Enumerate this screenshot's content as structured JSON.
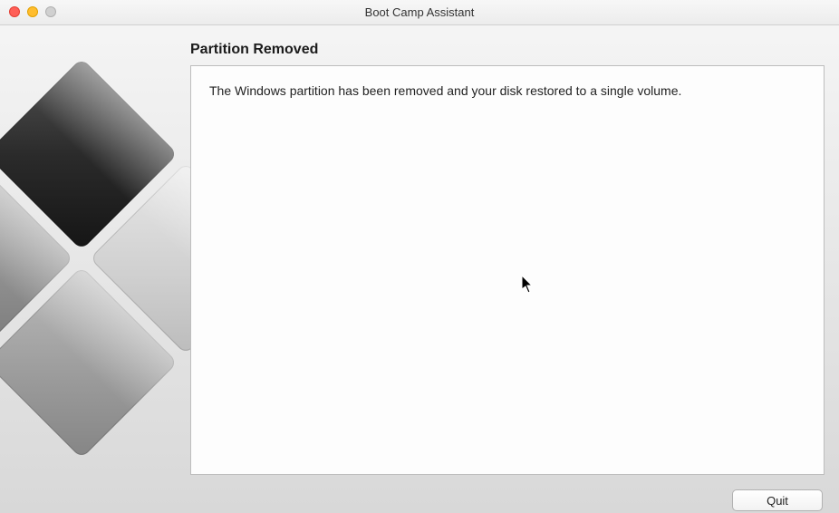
{
  "window": {
    "title": "Boot Camp Assistant"
  },
  "heading": "Partition Removed",
  "body": "The Windows partition has been removed and your disk restored to a single volume.",
  "buttons": {
    "quit": "Quit"
  }
}
